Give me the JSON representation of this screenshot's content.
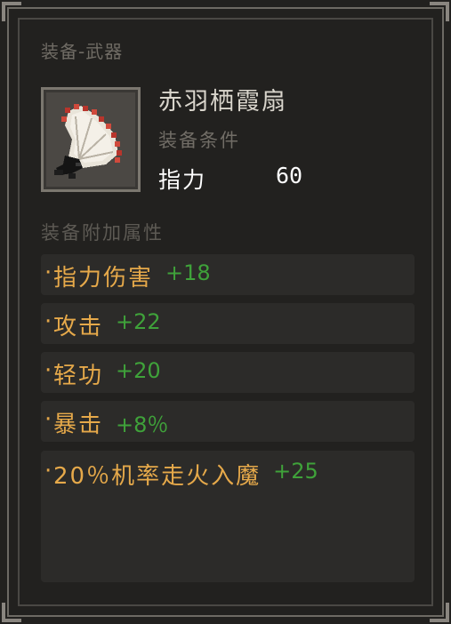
{
  "tooltip": {
    "category": "装备-武器",
    "item": {
      "name": "赤羽栖霞扇",
      "icon": "feather-fan-icon"
    },
    "requirement": {
      "title": "装备条件",
      "stat": "指力",
      "value": "60"
    },
    "attributes_title": "装备附加属性",
    "attributes": [
      {
        "bullet": "·",
        "name": "指力伤害",
        "value": "+18"
      },
      {
        "bullet": "·",
        "name": "攻击",
        "value": "+22"
      },
      {
        "bullet": "·",
        "name": "轻功",
        "value": "+20"
      },
      {
        "bullet": "·",
        "name": "暴击",
        "value": "+8％"
      },
      {
        "bullet": "·",
        "name": "20％机率走火入魔",
        "value": "+25"
      }
    ],
    "colors": {
      "attribute_name": "#e6a94a",
      "attribute_value": "#3fa23a",
      "panel_bg": "#22211f"
    }
  }
}
